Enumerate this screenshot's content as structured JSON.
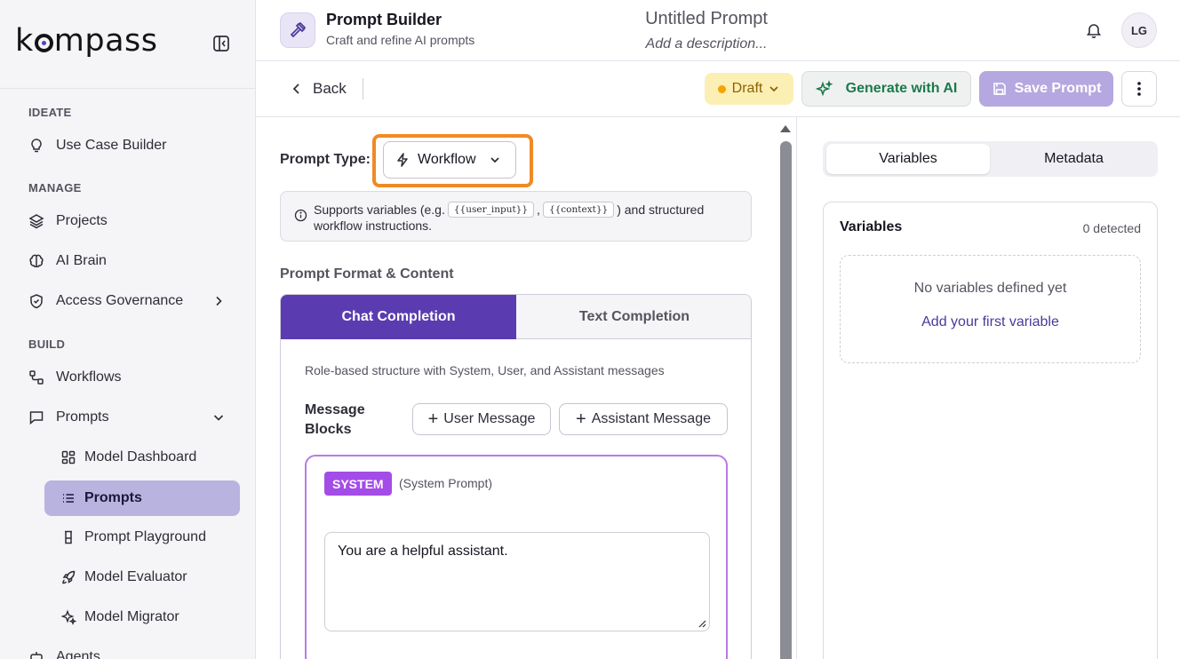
{
  "sidebar": {
    "logo": {
      "prefix": "k",
      "suffix": "mpass"
    },
    "sections": {
      "ideate": "IDEATE",
      "manage": "MANAGE",
      "build": "BUILD"
    },
    "items": [
      {
        "label": "Use Case Builder",
        "icon": "lightbulb-icon"
      },
      {
        "label": "Projects",
        "icon": "layers-icon"
      },
      {
        "label": "AI Brain",
        "icon": "brain-icon"
      },
      {
        "label": "Access Governance",
        "icon": "shield-icon"
      },
      {
        "label": "Workflows",
        "icon": "workflow-icon"
      },
      {
        "label": "Prompts",
        "icon": "message-square-icon"
      },
      {
        "label": "Model Dashboard",
        "icon": "grid-icon"
      },
      {
        "label": "Prompts",
        "icon": "list-icon"
      },
      {
        "label": "Prompt Playground",
        "icon": "flask-icon"
      },
      {
        "label": "Model Evaluator",
        "icon": "rocket-icon"
      },
      {
        "label": "Model Migrator",
        "icon": "sparkles-icon"
      },
      {
        "label": "Agents",
        "icon": "agent-icon"
      }
    ]
  },
  "header": {
    "app_title": "Prompt Builder",
    "app_subtitle": "Craft and refine AI prompts",
    "doc_title": "Untitled Prompt",
    "doc_description": "Add a description...",
    "avatar_initials": "LG"
  },
  "toolbar": {
    "back_label": "Back",
    "status_label": "Draft",
    "generate_label": "Generate with AI",
    "save_label": "Save Prompt"
  },
  "main": {
    "prompt_type_label": "Prompt Type:",
    "prompt_type_value": "Workflow",
    "info": {
      "text_before": "Supports variables (e.g.",
      "chip1": "{{user_input}}",
      "separator": ",",
      "chip2": "{{context}}",
      "text_after": ") and structured",
      "line2": "workflow instructions."
    },
    "section_title": "Prompt Format & Content",
    "tabs": {
      "chat": "Chat Completion",
      "text": "Text Completion"
    },
    "format_description": "Role-based structure with System, User, and Assistant messages",
    "message_blocks_label": "Message Blocks",
    "add_user_label": "User Message",
    "add_assistant_label": "Assistant Message",
    "system": {
      "badge": "SYSTEM",
      "subtitle": "(System Prompt)",
      "content": "You are a helpful assistant."
    }
  },
  "right": {
    "tabs": {
      "variables": "Variables",
      "metadata": "Metadata"
    },
    "variables_title": "Variables",
    "variables_count": "0 detected",
    "empty_message": "No variables defined yet",
    "add_first_link": "Add your first variable"
  },
  "colors": {
    "accent": "#5a3cb0",
    "highlight": "#f08a24",
    "draft_bg": "#fcefb4",
    "generate_text": "#1b7a4b",
    "save_bg": "#b5a8e0",
    "system_badge": "#a44ce8"
  }
}
